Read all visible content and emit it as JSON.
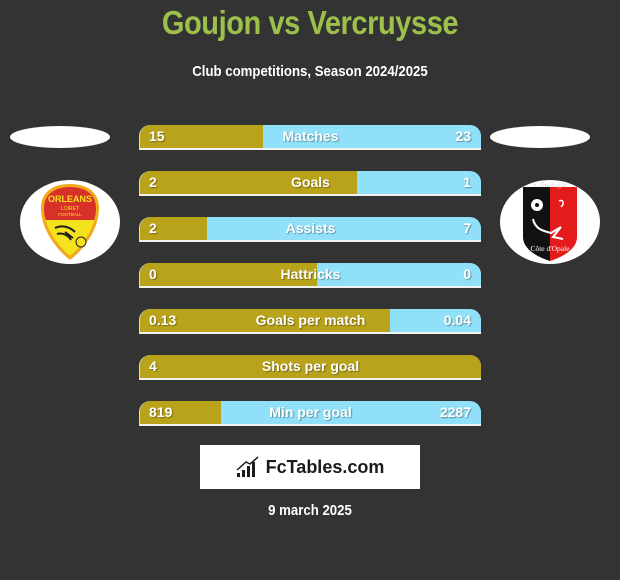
{
  "header": {
    "title": "Goujon vs Vercruysse",
    "subtitle": "Club competitions, Season 2024/2025"
  },
  "teams": {
    "left": {
      "logo_icon": "orleans-loiret-football-crest-icon",
      "logo_text": [
        "ORLEANS",
        "LOIRET",
        "FOOTBALL"
      ]
    },
    "right": {
      "logo_icon": "us-boulogne-cote-d-opale-crest-icon",
      "logo_text": [
        "S. Boulogne",
        "Côte d'Opale"
      ]
    }
  },
  "colors": {
    "background": "#333333",
    "title": "#9dc04b",
    "left_bar": "#b9a31a",
    "right_bar": "#8fe0f8"
  },
  "stats": [
    {
      "label": "Matches",
      "left": "15",
      "right": "23",
      "left_share": 0.36
    },
    {
      "label": "Goals",
      "left": "2",
      "right": "1",
      "left_share": 0.635
    },
    {
      "label": "Assists",
      "left": "2",
      "right": "7",
      "left_share": 0.196
    },
    {
      "label": "Hattricks",
      "left": "0",
      "right": "0",
      "left_share": 0.52
    },
    {
      "label": "Goals per match",
      "left": "0.13",
      "right": "0.04",
      "left_share": 0.734
    },
    {
      "label": "Shots per goal",
      "left": "4",
      "right": "",
      "left_share": 1.0
    },
    {
      "label": "Min per goal",
      "left": "819",
      "right": "2287",
      "left_share": 0.237
    }
  ],
  "brand": {
    "icon": "bar-chart-trend-icon",
    "name": "FcTables.com"
  },
  "date": "9 march 2025"
}
